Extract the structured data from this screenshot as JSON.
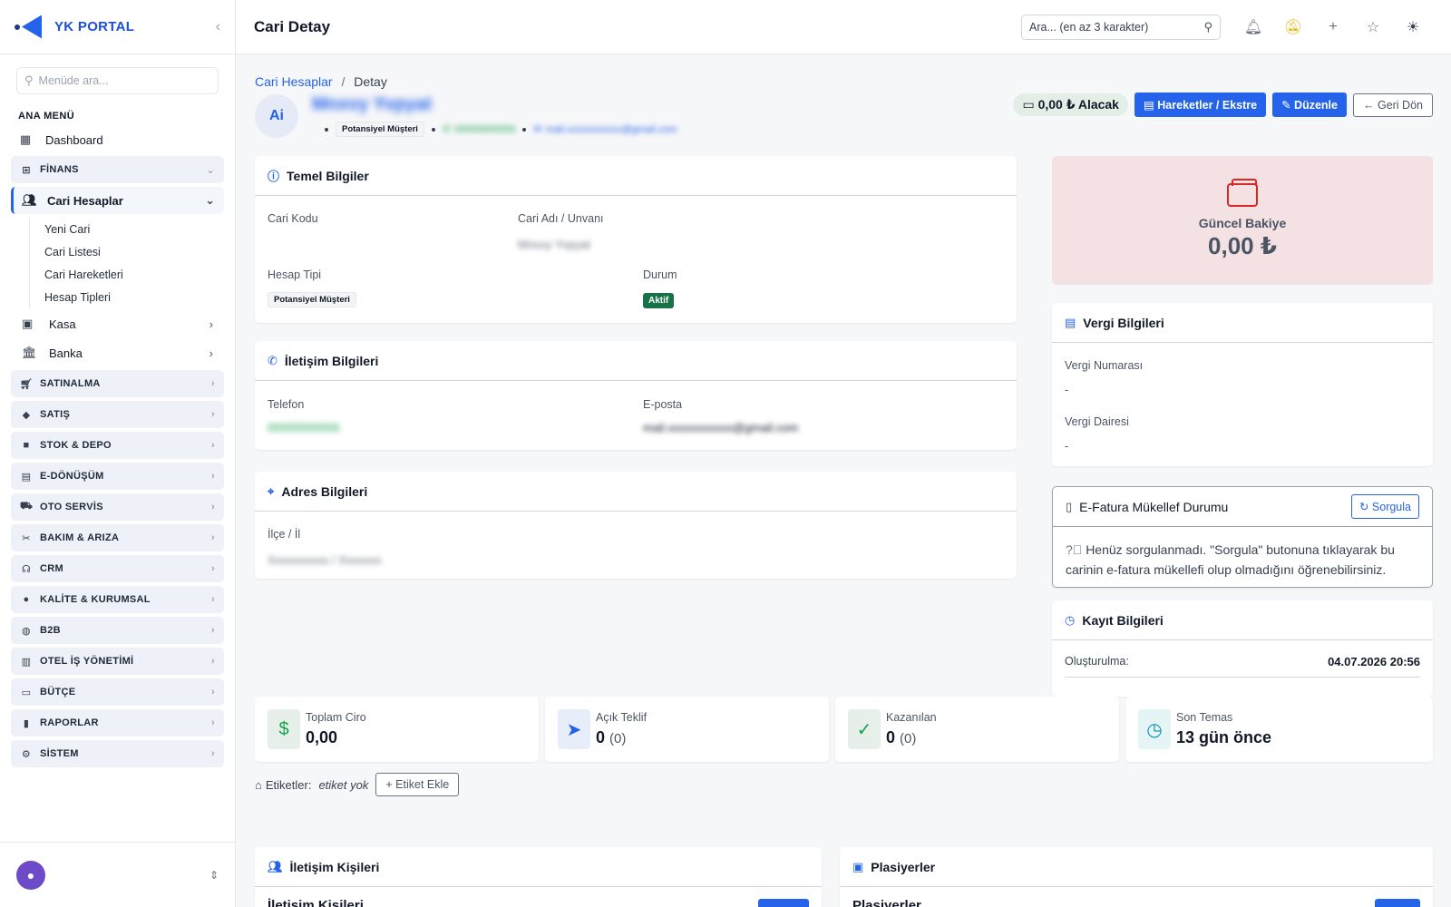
{
  "brand": {
    "name": "YK PORTAL"
  },
  "sidebar": {
    "search_placeholder": "Menüde ara...",
    "section_label": "ANA MENÜ",
    "dashboard": "Dashboard",
    "finans": "FİNANS",
    "cari": {
      "label": "Cari Hesaplar",
      "children": [
        "Yeni Cari",
        "Cari Listesi",
        "Cari Hareketleri",
        "Hesap Tipleri"
      ]
    },
    "kasa": "Kasa",
    "banka": "Banka",
    "groups": [
      "SATINALMA",
      "SATIŞ",
      "STOK & DEPO",
      "E-DÖNÜŞÜM",
      "OTO SERVİS",
      "BAKIM & ARIZA",
      "CRM",
      "KALİTE & KURUMSAL",
      "B2B",
      "OTEL İŞ YÖNETİMİ",
      "BÜTÇE",
      "RAPORLAR",
      "SİSTEM"
    ]
  },
  "header": {
    "title": "Cari Detay",
    "search_placeholder": "Ara... (en az 3 karakter)"
  },
  "breadcrumb": {
    "root": "Cari Hesaplar",
    "sep": "/",
    "current": "Detay"
  },
  "customer": {
    "initials": "Ai",
    "name": "Mnxvy Yvpyat",
    "account_type": "Potansiyel Müşteri",
    "phone": "05555555555",
    "email": "mail.xxxxxxxxxxx@gmail.com"
  },
  "actions": {
    "balance_pill": "0,00 ₺ Alacak",
    "ledger": "Hareketler / Ekstre",
    "edit": "Düzenle",
    "back": "Geri Dön"
  },
  "basic": {
    "title": "Temel Bilgiler",
    "code_label": "Cari Kodu",
    "name_label": "Cari Adı / Unvanı",
    "name_value": "Mnxvy Yvpyat",
    "type_label": "Hesap Tipi",
    "type_value": "Potansiyel Müşteri",
    "status_label": "Durum",
    "status_value": "Aktif"
  },
  "contact": {
    "title": "İletişim Bilgileri",
    "phone_label": "Telefon",
    "phone_value": "05555555555",
    "email_label": "E-posta",
    "email_value": "mail.xxxxxxxxxxx@gmail.com"
  },
  "address": {
    "title": "Adres Bilgileri",
    "label": "İlçe / İl",
    "value": "Xxxxxxxxxx / Xxxxxxx"
  },
  "balance": {
    "label": "Güncel Bakiye",
    "value": "0,00 ₺"
  },
  "tax": {
    "title": "Vergi Bilgileri",
    "number_label": "Vergi Numarası",
    "number_value": "-",
    "office_label": "Vergi Dairesi",
    "office_value": "-"
  },
  "efatura": {
    "title": "E-Fatura Mükellef Durumu",
    "button": "Sorgula",
    "message": "Henüz sorgulanmadı. \"Sorgula\" butonuna tıklayarak bu carinin e-fatura mükellefi olup olmadığını öğrenebilirsiniz."
  },
  "record": {
    "title": "Kayıt Bilgileri",
    "created_label": "Oluşturulma:",
    "created_value": "04.07.2026 20:56"
  },
  "stats": [
    {
      "label": "Toplam Ciro",
      "value": "0,00",
      "extra": ""
    },
    {
      "label": "Açık Teklif",
      "value": "0",
      "extra": "(0)"
    },
    {
      "label": "Kazanılan",
      "value": "0",
      "extra": "(0)"
    },
    {
      "label": "Son Temas",
      "value": "13 gün önce",
      "extra": ""
    }
  ],
  "tags": {
    "label": "Etiketler:",
    "empty": "etiket yok",
    "add": "Etiket Ekle"
  },
  "bottom": {
    "contacts_title": "İletişim Kişileri",
    "contacts_sub": "İletişim Kişileri",
    "reps_title": "Plasiyerler",
    "reps_sub": "Plasiyerler"
  },
  "colors": {
    "primary": "#2563eb",
    "success": "#157347",
    "balance_bg": "#f3e1e4"
  }
}
